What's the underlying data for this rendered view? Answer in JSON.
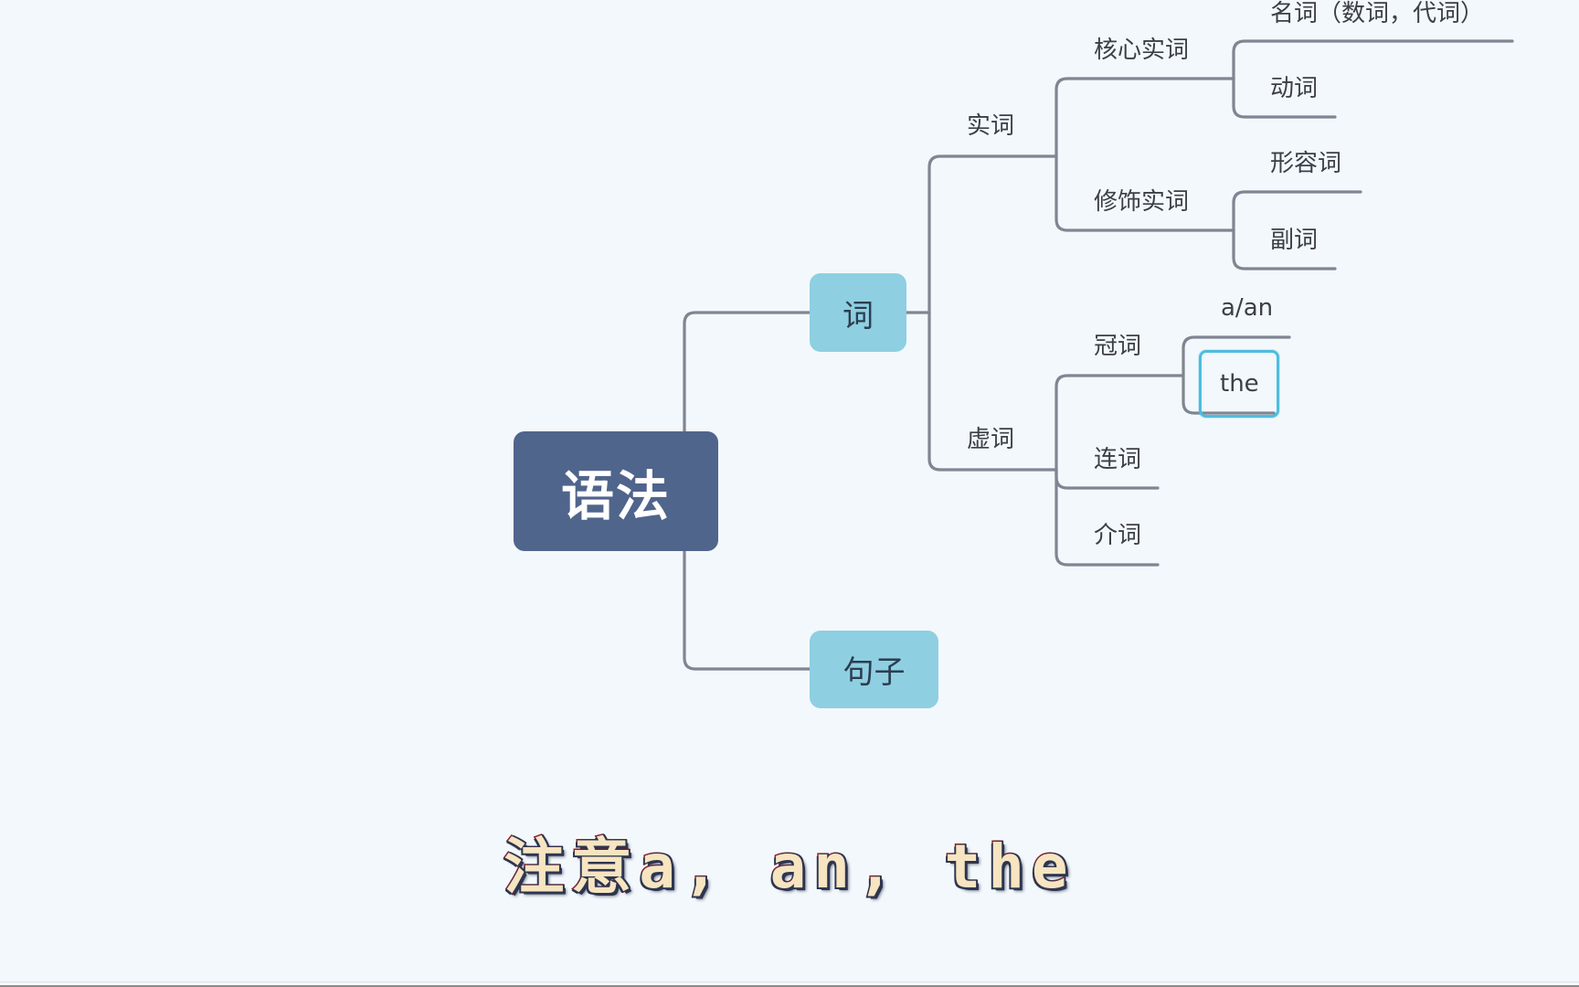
{
  "mindmap": {
    "root": {
      "label": "语法",
      "color": "#50658c"
    },
    "branches": [
      {
        "label": "词",
        "color": "#8ecfe2",
        "children": [
          {
            "label": "实词",
            "children": [
              {
                "label": "核心实词",
                "children": [
                  {
                    "label": "名词（数词，代词）"
                  },
                  {
                    "label": "动词"
                  }
                ]
              },
              {
                "label": "修饰实词",
                "children": [
                  {
                    "label": "形容词"
                  },
                  {
                    "label": "副词"
                  }
                ]
              }
            ]
          },
          {
            "label": "虚词",
            "children": [
              {
                "label": "冠词",
                "children": [
                  {
                    "label": "a/an"
                  },
                  {
                    "label": "the",
                    "selected": true
                  }
                ]
              },
              {
                "label": "连词"
              },
              {
                "label": "介词"
              }
            ]
          }
        ]
      },
      {
        "label": "句子",
        "color": "#8ecfe2"
      }
    ],
    "connector_color": "#7f8592",
    "selection_color": "#4cbde0"
  },
  "subtitle": {
    "text": "注意a, an, the"
  }
}
